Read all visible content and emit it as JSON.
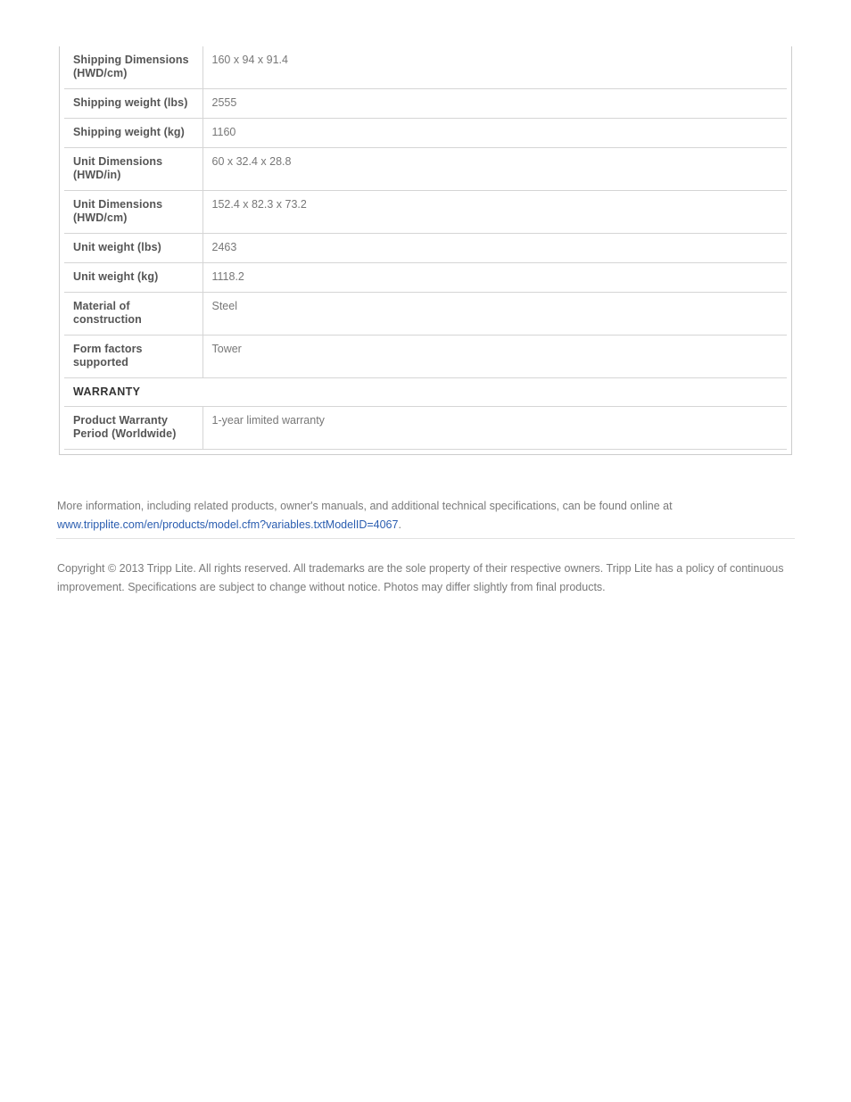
{
  "document": {
    "table": {
      "rows": [
        {
          "kind": "spec",
          "lines": 2,
          "label": "Shipping Dimensions (HWD/cm)",
          "label_line1": "Shipping Dimensions",
          "label_line2": "(HWD/cm)",
          "value": "160 x 94 x 91.4"
        },
        {
          "kind": "spec",
          "lines": 1,
          "label": "Shipping weight (lbs)",
          "label_line1": "Shipping weight (lbs)",
          "label_line2": "",
          "value": "2555"
        },
        {
          "kind": "spec",
          "lines": 1,
          "label": "Shipping weight (kg)",
          "label_line1": "Shipping weight (kg)",
          "label_line2": "",
          "value": "1160"
        },
        {
          "kind": "spec",
          "lines": 2,
          "label": "Unit Dimensions (HWD/in)",
          "label_line1": "Unit Dimensions",
          "label_line2": "(HWD/in)",
          "value": "60 x 32.4 x 28.8"
        },
        {
          "kind": "spec",
          "lines": 2,
          "label": "Unit Dimensions (HWD/cm)",
          "label_line1": "Unit Dimensions",
          "label_line2": "(HWD/cm)",
          "value": "152.4 x 82.3 x 73.2"
        },
        {
          "kind": "spec",
          "lines": 1,
          "label": "Unit weight (lbs)",
          "label_line1": "Unit weight (lbs)",
          "label_line2": "",
          "value": "2463"
        },
        {
          "kind": "spec",
          "lines": 1,
          "label": "Unit weight (kg)",
          "label_line1": "Unit weight (kg)",
          "label_line2": "",
          "value": "1118.2"
        },
        {
          "kind": "spec",
          "lines": 2,
          "label": "Material of construction",
          "label_line1": "Material of",
          "label_line2": "construction",
          "value": "Steel"
        },
        {
          "kind": "spec",
          "lines": 2,
          "label": "Form factors supported",
          "label_line1": "Form factors",
          "label_line2": "supported",
          "value": "Tower"
        },
        {
          "kind": "section",
          "lines": 1,
          "label": "WARRANTY",
          "label_line1": "WARRANTY",
          "label_line2": "",
          "value": ""
        },
        {
          "kind": "spec",
          "lines": 2,
          "label": "Product Warranty Period (Worldwide)",
          "label_line1": "Product Warranty",
          "label_line2": "Period (Worldwide)",
          "value": "1-year limited warranty"
        }
      ]
    },
    "more_info": {
      "lead_text": "More information, including related products, owner's manuals, and additional technical specifications, can be found online at ",
      "link_text": "www.tripplite.com/en/products/model.cfm?variables.txtModelID=4067",
      "trailing_period": "."
    },
    "copyright": {
      "text": "Copyright © 2013 Tripp Lite. All rights reserved. All trademarks are the sole property of their respective owners. Tripp Lite has a policy of continuous improvement. Specifications are subject to change without notice. Photos may differ slightly from final products."
    },
    "colors": {
      "label_text": "#555555",
      "value_text": "#777777",
      "section_text": "#333333",
      "link": "#2a5db0",
      "body_text": "#7a7a7a",
      "border": "#d5d5d5",
      "outer_border": "#cccccc",
      "background": "#ffffff"
    }
  }
}
